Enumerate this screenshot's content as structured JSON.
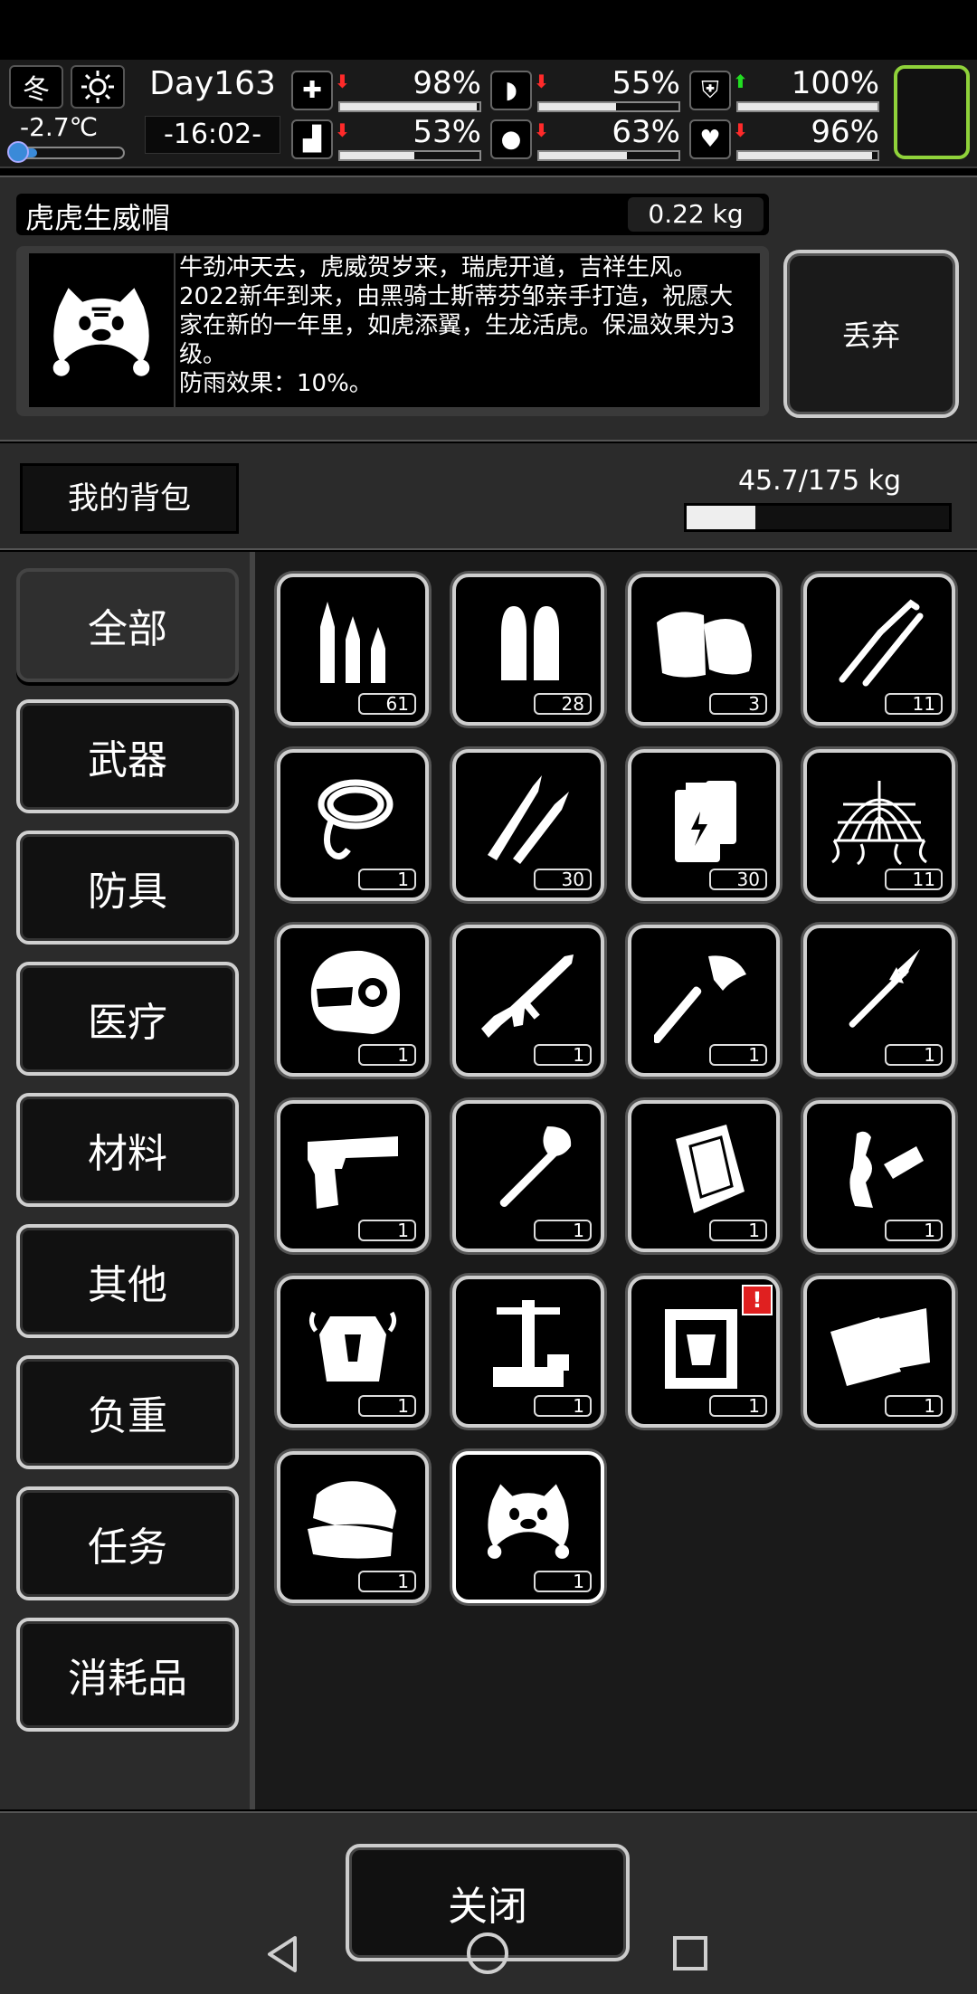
{
  "hud": {
    "season": "冬",
    "temperature": "-2.7℃",
    "day": "Day163",
    "time": "-16:02-",
    "stats": [
      {
        "icon": "health-icon",
        "trend": "down",
        "value": "98%",
        "level": 0.98
      },
      {
        "icon": "stomach-icon",
        "trend": "down",
        "value": "55%",
        "level": 0.55
      },
      {
        "icon": "armor-icon",
        "trend": "up",
        "value": "100%",
        "level": 1.0
      },
      {
        "icon": "leg-icon",
        "trend": "down",
        "value": "53%",
        "level": 0.53
      },
      {
        "icon": "water-drop-icon",
        "trend": "down",
        "value": "63%",
        "level": 0.63
      },
      {
        "icon": "heart-icon",
        "trend": "down",
        "value": "96%",
        "level": 0.96
      }
    ]
  },
  "detail": {
    "name": "虎虎生威帽",
    "weight": "0.22 kg",
    "description": "牛劲冲天去，虎威贺岁来，瑞虎开道，吉祥生风。2022新年到来，由黑骑士斯蒂芬邹亲手打造，祝愿大家在新的一年里，如虎添翼，生龙活虎。保温效果为3级。",
    "rain_effect": "防雨效果：10%。",
    "discard_label": "丢弃"
  },
  "bag": {
    "label": "我的背包",
    "capacity": "45.7/175 kg",
    "capacity_level": 0.261
  },
  "categories": [
    "全部",
    "武器",
    "防具",
    "医疗",
    "材料",
    "其他",
    "负重",
    "任务",
    "消耗品"
  ],
  "items": [
    {
      "name": "rifle-bullets",
      "count": "61"
    },
    {
      "name": "pistol-bullets",
      "count": "28"
    },
    {
      "name": "cloth-bandage",
      "count": "3"
    },
    {
      "name": "lockpicks",
      "count": "11"
    },
    {
      "name": "rope",
      "count": "1"
    },
    {
      "name": "sniper-rounds",
      "count": "30"
    },
    {
      "name": "batteries",
      "count": "30"
    },
    {
      "name": "net",
      "count": "11"
    },
    {
      "name": "combat-helmet",
      "count": "1"
    },
    {
      "name": "assault-rifle",
      "count": "1"
    },
    {
      "name": "axe",
      "count": "1"
    },
    {
      "name": "spear",
      "count": "1"
    },
    {
      "name": "pistol",
      "count": "1"
    },
    {
      "name": "shovel",
      "count": "1"
    },
    {
      "name": "vest-plate",
      "count": "1"
    },
    {
      "name": "junk-parts",
      "count": "1"
    },
    {
      "name": "body-armor",
      "count": "1"
    },
    {
      "name": "tool-stand",
      "count": "1"
    },
    {
      "name": "mystery-box",
      "count": "1",
      "alert": "!"
    },
    {
      "name": "cloth-pieces",
      "count": "1"
    },
    {
      "name": "folded-clothes",
      "count": "1"
    },
    {
      "name": "tiger-hat",
      "count": "1",
      "selected": true
    }
  ],
  "close_label": "关闭"
}
